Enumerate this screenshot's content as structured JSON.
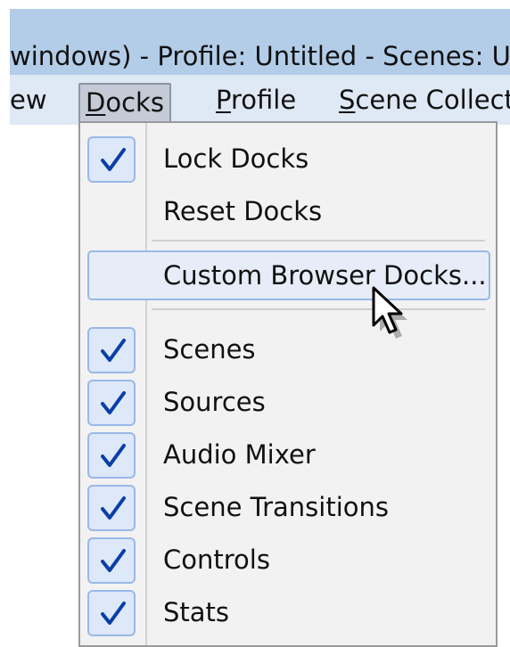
{
  "window": {
    "title": "windows) - Profile: Untitled - Scenes: Ur"
  },
  "menubar": {
    "items": [
      {
        "label": "ew"
      },
      {
        "label_ul": "D",
        "label_rest": "ocks"
      },
      {
        "label_ul": "P",
        "label_rest": "rofile"
      },
      {
        "label_ul": "S",
        "label_rest": "cene Collect"
      }
    ]
  },
  "docks_menu": {
    "lock_docks": "Lock Docks",
    "reset_docks": "Reset Docks",
    "custom_browser_docks": "Custom Browser Docks...",
    "scenes": "Scenes",
    "sources": "Sources",
    "audio_mixer": "Audio Mixer",
    "scene_transitions": "Scene Transitions",
    "controls": "Controls",
    "stats": "Stats"
  },
  "colors": {
    "check": "#0a3ea8",
    "titlebar": "#b3cde8",
    "menubar": "#dfe8f5",
    "menu_bg": "#f2f2f2"
  }
}
